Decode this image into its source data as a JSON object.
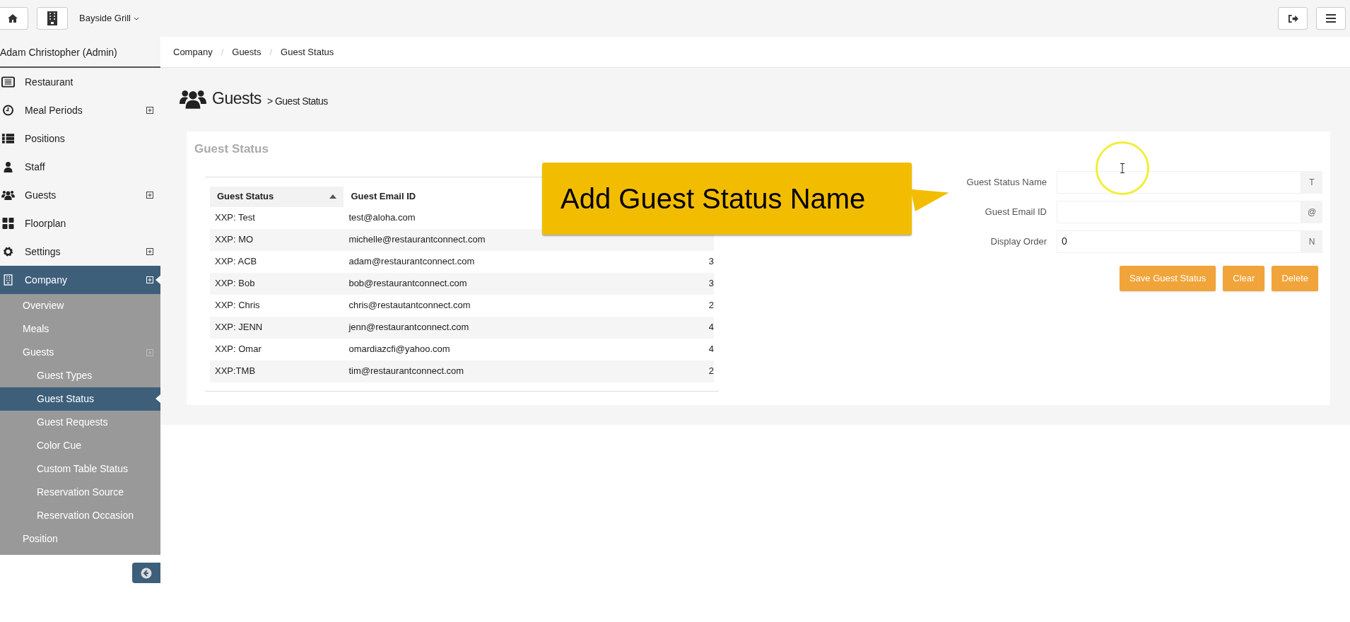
{
  "topbar": {
    "restaurant": "Bayside Grill"
  },
  "sidebar": {
    "user": "Adam Christopher (Admin)",
    "items": [
      {
        "label": "Restaurant",
        "expandable": false,
        "selected": false
      },
      {
        "label": "Meal Periods",
        "expandable": true,
        "selected": false
      },
      {
        "label": "Positions",
        "expandable": false,
        "selected": false
      },
      {
        "label": "Staff",
        "expandable": false,
        "selected": false
      },
      {
        "label": "Guests",
        "expandable": true,
        "selected": false
      },
      {
        "label": "Floorplan",
        "expandable": false,
        "selected": false
      },
      {
        "label": "Settings",
        "expandable": true,
        "selected": false
      },
      {
        "label": "Company",
        "expandable": true,
        "selected": true,
        "children": [
          {
            "label": "Overview",
            "selected": false
          },
          {
            "label": "Meals",
            "selected": false
          },
          {
            "label": "Guests",
            "selected": false,
            "expandable": true,
            "children": [
              {
                "label": "Guest Types",
                "selected": false
              },
              {
                "label": "Guest Status",
                "selected": true
              },
              {
                "label": "Guest Requests",
                "selected": false
              },
              {
                "label": "Color Cue",
                "selected": false
              },
              {
                "label": "Custom Table Status",
                "selected": false
              },
              {
                "label": "Reservation Source",
                "selected": false
              },
              {
                "label": "Reservation Occasion",
                "selected": false
              }
            ]
          },
          {
            "label": "Position",
            "selected": false
          }
        ]
      }
    ]
  },
  "breadcrumb": [
    {
      "label": "Company"
    },
    {
      "separator": "/",
      "label": "Guests"
    },
    {
      "separator": "/",
      "label": "Guest Status"
    }
  ],
  "page_title": {
    "title": "Guests",
    "subtitle": "> Guest Status"
  },
  "panel": {
    "title": "Guest Status",
    "table": {
      "columns": [
        {
          "label": "Guest Status",
          "sorted": true
        },
        {
          "label": "Guest Email ID",
          "sorted": false
        }
      ],
      "rows": [
        [
          "XXP: Test",
          "test@aloha.com",
          null
        ],
        [
          "XXP: MO",
          "michelle@restaurantconnect.com",
          null
        ],
        [
          "XXP: ACB",
          "adam@restaurantconnect.com",
          "3"
        ],
        [
          "XXP: Bob",
          "bob@restaurantconnect.com",
          "3"
        ],
        [
          "XXP: Chris",
          "chris@restautantconnect.com",
          "2"
        ],
        [
          "XXP: JENN",
          "jenn@restaurantconnect.com",
          "4"
        ],
        [
          "XXP: Omar",
          "omardiazcfi@yahoo.com",
          "4"
        ],
        [
          "XXP:TMB",
          "tim@restaurantconnect.com",
          "2"
        ]
      ]
    },
    "form": {
      "fields": [
        {
          "label": "Guest Status Name",
          "addon": "T"
        },
        {
          "label": "Guest Email ID",
          "addon": "@"
        },
        {
          "label": "Display Order",
          "value": "0",
          "addon": "N"
        }
      ],
      "buttons": [
        "Save Guest Status",
        "Clear",
        "Delete"
      ]
    }
  },
  "callout": {
    "text": "Add Guest Status Name"
  }
}
